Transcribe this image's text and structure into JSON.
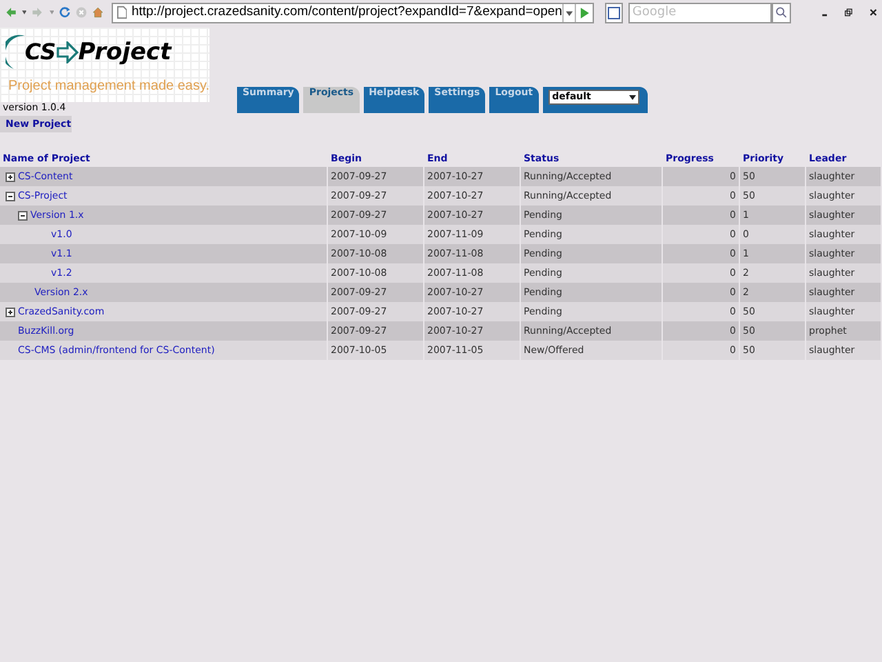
{
  "browser": {
    "url": "http://project.crazedsanity.com/content/project?expandId=7&expand=open",
    "search_placeholder": "Google"
  },
  "logo": {
    "left": "CS",
    "right": "Project",
    "tagline": "Project management made easy."
  },
  "version": "version 1.0.4",
  "new_project": "New Project",
  "tabs": [
    {
      "label": "Summary",
      "selected": false
    },
    {
      "label": "Projects",
      "selected": true
    },
    {
      "label": "Helpdesk",
      "selected": false
    },
    {
      "label": "Settings",
      "selected": false
    },
    {
      "label": "Logout",
      "selected": false
    }
  ],
  "group_select": {
    "value": "default"
  },
  "table": {
    "columns": [
      "Name of Project",
      "Begin",
      "End",
      "Status",
      "Progress",
      "Priority",
      "Leader"
    ],
    "rows": [
      {
        "name": "CS-Content",
        "expanded": false,
        "begin": "2007-09-27",
        "end": "2007-10-27",
        "status": "Running/Accepted",
        "progress": "0",
        "priority": "50",
        "leader": "slaughter"
      },
      {
        "name": "CS-Project",
        "expanded": true,
        "begin": "2007-09-27",
        "end": "2007-10-27",
        "status": "Running/Accepted",
        "progress": "0",
        "priority": "50",
        "leader": "slaughter",
        "children": [
          {
            "name": "Version 1.x",
            "expanded": true,
            "begin": "2007-09-27",
            "end": "2007-10-27",
            "status": "Pending",
            "progress": "0",
            "priority": "1",
            "leader": "slaughter",
            "children": [
              {
                "name": "v1.0",
                "begin": "2007-10-09",
                "end": "2007-11-09",
                "status": "Pending",
                "progress": "0",
                "priority": "0",
                "leader": "slaughter"
              },
              {
                "name": "v1.1",
                "begin": "2007-10-08",
                "end": "2007-11-08",
                "status": "Pending",
                "progress": "0",
                "priority": "1",
                "leader": "slaughter"
              },
              {
                "name": "v1.2",
                "begin": "2007-10-08",
                "end": "2007-11-08",
                "status": "Pending",
                "progress": "0",
                "priority": "2",
                "leader": "slaughter"
              }
            ]
          },
          {
            "name": "Version 2.x",
            "begin": "2007-09-27",
            "end": "2007-10-27",
            "status": "Pending",
            "progress": "0",
            "priority": "2",
            "leader": "slaughter"
          }
        ]
      },
      {
        "name": "CrazedSanity.com",
        "expanded": false,
        "begin": "2007-09-27",
        "end": "2007-10-27",
        "status": "Pending",
        "progress": "0",
        "priority": "50",
        "leader": "slaughter"
      },
      {
        "name": "BuzzKill.org",
        "begin": "2007-09-27",
        "end": "2007-10-27",
        "status": "Running/Accepted",
        "progress": "0",
        "priority": "50",
        "leader": "prophet"
      },
      {
        "name": "CS-CMS (admin/frontend for CS-Content)",
        "begin": "2007-10-05",
        "end": "2007-11-05",
        "status": "New/Offered",
        "progress": "0",
        "priority": "50",
        "leader": "slaughter"
      }
    ]
  }
}
